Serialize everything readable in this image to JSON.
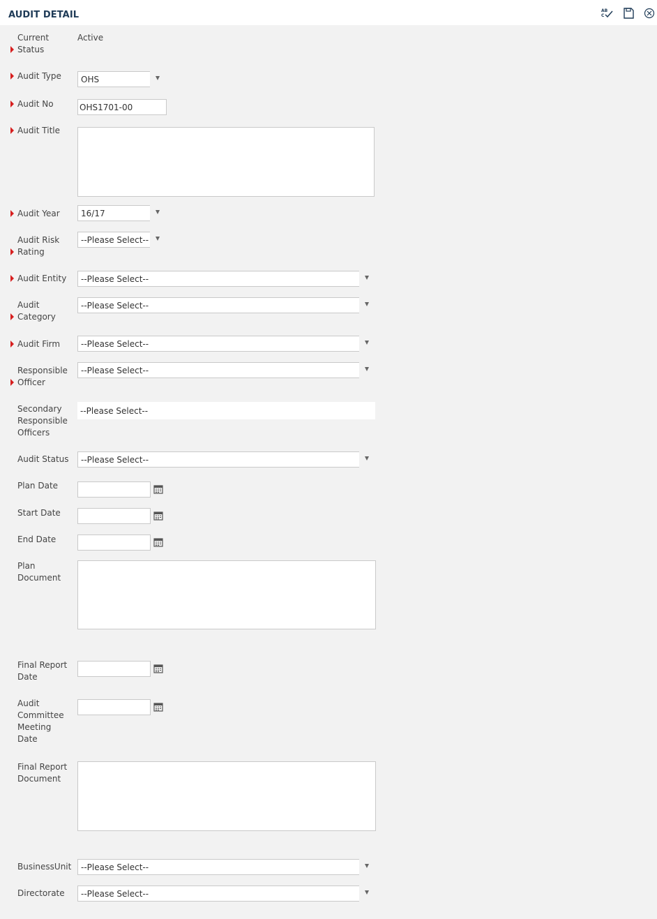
{
  "header": {
    "title": "AUDIT DETAIL",
    "icons": [
      "spellcheck-icon",
      "save-icon",
      "close-icon"
    ]
  },
  "colors": {
    "required_marker": "#d71f1f",
    "title": "#1f3b57",
    "background": "#f2f2f2"
  },
  "form": {
    "current_status": {
      "label": "Current Status",
      "value": "Active"
    },
    "audit_type": {
      "label": "Audit Type",
      "value": "OHS"
    },
    "audit_no": {
      "label": "Audit No",
      "value": "OHS1701-00"
    },
    "audit_title": {
      "label": "Audit Title",
      "value": ""
    },
    "audit_year": {
      "label": "Audit Year",
      "value": "16/17"
    },
    "audit_risk_rating": {
      "label": "Audit Risk Rating",
      "value": "--Please Select--"
    },
    "audit_entity": {
      "label": "Audit Entity",
      "value": "--Please Select--"
    },
    "audit_category": {
      "label": "Audit Category",
      "value": "--Please Select--"
    },
    "audit_firm": {
      "label": "Audit Firm",
      "value": "--Please Select--"
    },
    "responsible_officer": {
      "label": "Responsible Officer",
      "value": "--Please Select--"
    },
    "secondary_responsible_officers": {
      "label": "Secondary Responsible Officers",
      "value": "--Please Select--"
    },
    "audit_status": {
      "label": "Audit Status",
      "value": "--Please Select--"
    },
    "plan_date": {
      "label": "Plan Date",
      "value": ""
    },
    "start_date": {
      "label": "Start Date",
      "value": ""
    },
    "end_date": {
      "label": "End Date",
      "value": ""
    },
    "plan_document": {
      "label": "Plan Document",
      "value": ""
    },
    "final_report_date": {
      "label": "Final Report Date",
      "value": ""
    },
    "audit_committee_meeting_date": {
      "label": "Audit Committee Meeting Date",
      "value": ""
    },
    "final_report_document": {
      "label": "Final Report Document",
      "value": ""
    },
    "business_unit": {
      "label": "BusinessUnit",
      "value": "--Please Select--"
    },
    "directorate": {
      "label": "Directorate",
      "value": "--Please Select--"
    }
  }
}
